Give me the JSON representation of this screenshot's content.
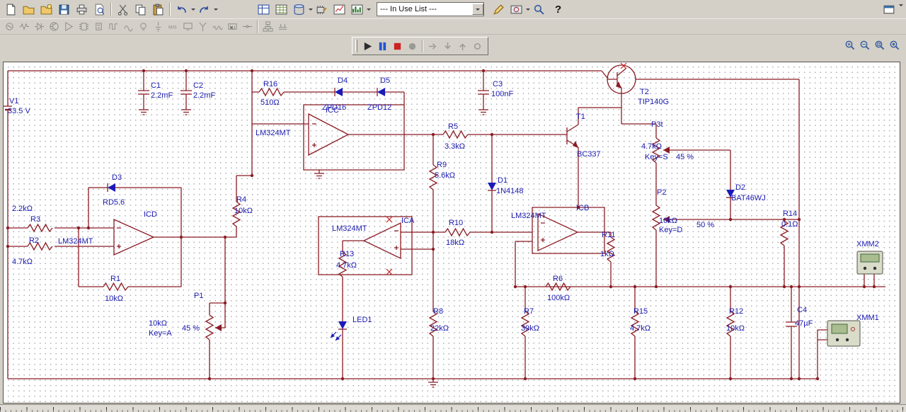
{
  "toolbar": {
    "in_use_list": "--- In Use List ---",
    "help": "?"
  },
  "sch": {
    "V1": {
      "ref": "V1",
      "val": "33.5 V"
    },
    "C1": {
      "ref": "C1",
      "val": "2.2mF"
    },
    "C2": {
      "ref": "C2",
      "val": "2.2mF"
    },
    "C3": {
      "ref": "C3",
      "val": "100nF"
    },
    "C4": {
      "ref": "C4",
      "val": "47µF"
    },
    "R1": {
      "ref": "R1",
      "val": "10kΩ"
    },
    "R2": {
      "ref": "R2",
      "val": "4.7kΩ"
    },
    "R3": {
      "ref": "R3",
      "val": "2.2kΩ"
    },
    "R4": {
      "ref": "R4",
      "val": "10kΩ"
    },
    "R5": {
      "ref": "R5",
      "val": "3.3kΩ"
    },
    "R6": {
      "ref": "R6",
      "val": "100kΩ"
    },
    "R7": {
      "ref": "R7",
      "val": "39kΩ"
    },
    "R8": {
      "ref": "R8",
      "val": "22kΩ"
    },
    "R9": {
      "ref": "R9",
      "val": "5.6kΩ"
    },
    "R10": {
      "ref": "R10",
      "val": "18kΩ"
    },
    "R11": {
      "ref": "R11",
      "val": "1kΩ"
    },
    "R12": {
      "ref": "R12",
      "val": "10kΩ"
    },
    "R13": {
      "ref": "R13",
      "val": "4.7kΩ"
    },
    "R14": {
      "ref": "R14",
      "val": "0.1Ω"
    },
    "R15": {
      "ref": "R15",
      "val": "4.7kΩ"
    },
    "R16": {
      "ref": "R16",
      "val": "510Ω"
    },
    "D1": {
      "ref": "D1",
      "val": "1N4148"
    },
    "D2": {
      "ref": "D2",
      "val": "BAT46WJ"
    },
    "D3": {
      "ref": "D3",
      "val": "RD5.6"
    },
    "D4": {
      "ref": "D4",
      "val": "ZPD16"
    },
    "D5": {
      "ref": "D5",
      "val": "ZPD12"
    },
    "LED1": {
      "ref": "LED1"
    },
    "T1": {
      "ref": "T1",
      "val": "BC337"
    },
    "T2": {
      "ref": "T2",
      "val": "TIP140G"
    },
    "P1": {
      "ref": "P1",
      "val": "10kΩ",
      "key": "Key=A",
      "pct": "45 %"
    },
    "P2": {
      "ref": "P2",
      "val": "10kΩ",
      "key": "Key=D",
      "pct": "50 %"
    },
    "P3t": {
      "ref": "P3t",
      "val": "4.7kΩ",
      "key": "Key=S",
      "pct": "45 %"
    },
    "ICA": {
      "ref": "ICA",
      "val": "LM324MT"
    },
    "ICB": {
      "ref": "ICB",
      "val": "LM324MT"
    },
    "ICC": {
      "ref": "ICC",
      "val": "LM324MT"
    },
    "ICD": {
      "ref": "ICD",
      "val": "LM324MT"
    },
    "XMM1": {
      "ref": "XMM1"
    },
    "XMM2": {
      "ref": "XMM2"
    }
  }
}
